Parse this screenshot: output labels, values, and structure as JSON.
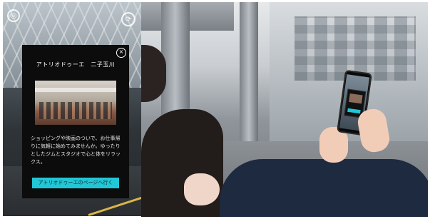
{
  "overlay_card": {
    "title": "アトリオドゥーエ　二子玉川",
    "description": "ショッピングや映画のついで、お仕事帰りに気軽に始めてみませんか。ゆったりとしたジムとスタジオで心と体をリラックス。",
    "cta_label": "アトリオドゥーエのページへ行く",
    "close_glyph": "×"
  },
  "controls": {
    "left_glyph": "◎",
    "right_glyph": "⟳"
  },
  "colors": {
    "cta": "#21c7d6",
    "card_bg": "#0c0c0c"
  }
}
